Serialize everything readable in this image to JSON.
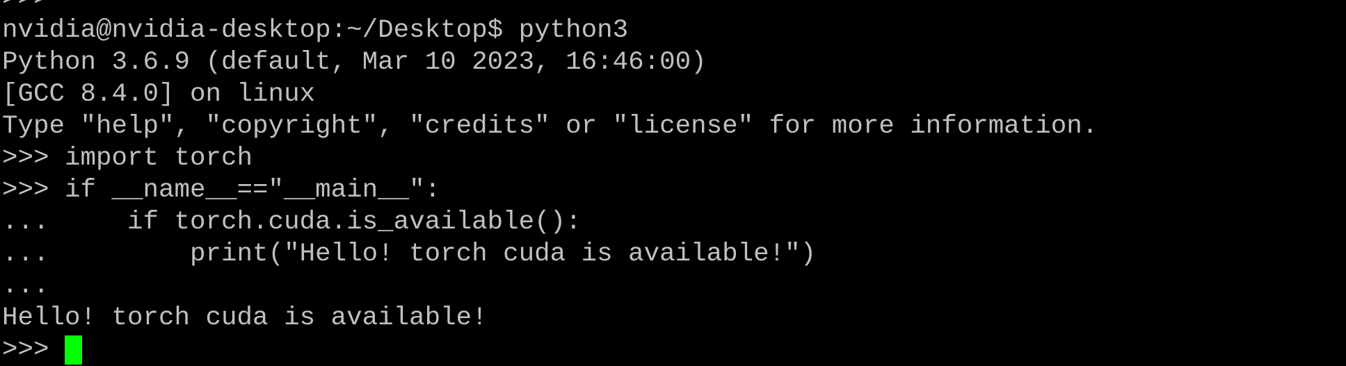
{
  "terminal": {
    "lines": [
      ">>>",
      "nvidia@nvidia-desktop:~/Desktop$ python3",
      "Python 3.6.9 (default, Mar 10 2023, 16:46:00)",
      "[GCC 8.4.0] on linux",
      "Type \"help\", \"copyright\", \"credits\" or \"license\" for more information.",
      ">>> import torch",
      ">>> if __name__==\"__main__\":",
      "...     if torch.cuda.is_available():",
      "...         print(\"Hello! torch cuda is available!\")",
      "...",
      "Hello! torch cuda is available!"
    ],
    "prompt": ">>> ",
    "colors": {
      "background": "#000000",
      "text": "#c0c0c0",
      "cursor": "#00ff00"
    }
  }
}
